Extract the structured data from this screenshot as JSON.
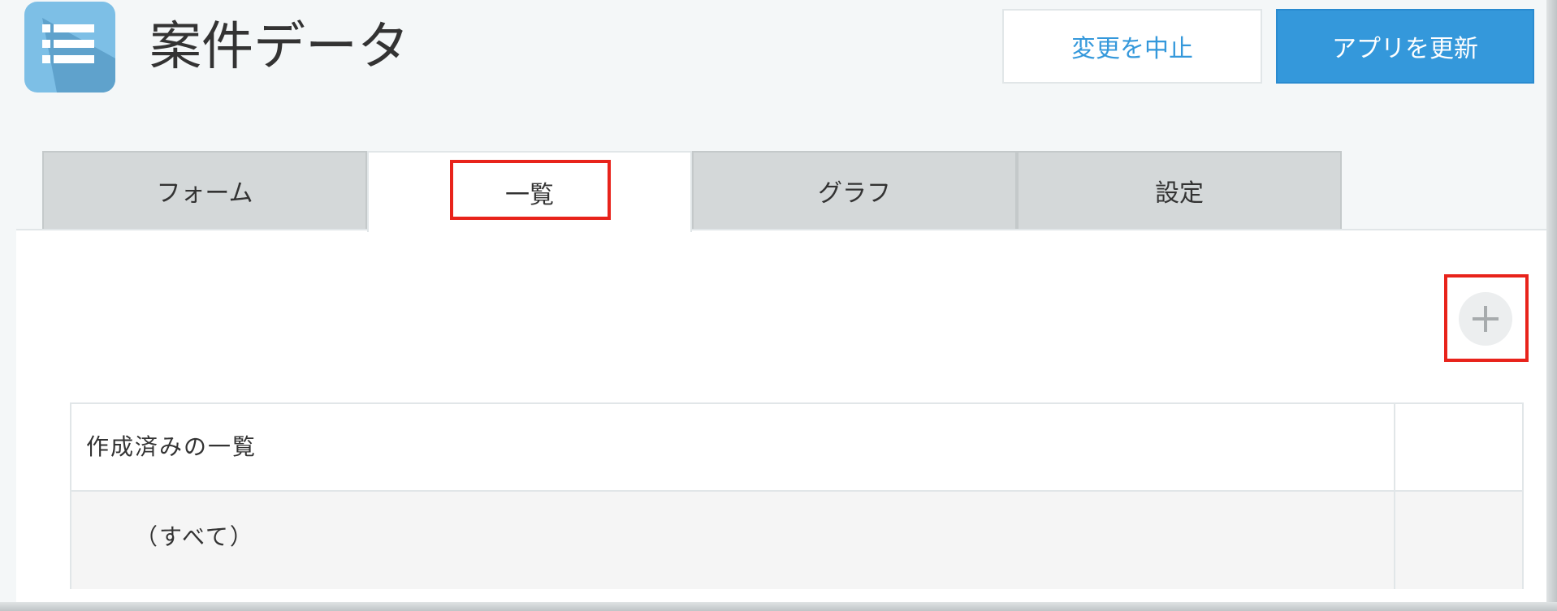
{
  "header": {
    "app_title": "案件データ",
    "app_icon": "list-icon",
    "cancel_label": "変更を中止",
    "update_label": "アプリを更新"
  },
  "tabs": [
    {
      "label": "フォーム",
      "active": false
    },
    {
      "label": "一覧",
      "active": true
    },
    {
      "label": "グラフ",
      "active": false
    },
    {
      "label": "設定",
      "active": false
    }
  ],
  "views": {
    "header": "作成済みの一覧",
    "rows": [
      {
        "label": "（すべて）"
      }
    ],
    "add_icon": "plus-icon"
  },
  "colors": {
    "accent": "#3498db",
    "highlight": "#e8231b",
    "tab_inactive": "#d4d8d9"
  }
}
